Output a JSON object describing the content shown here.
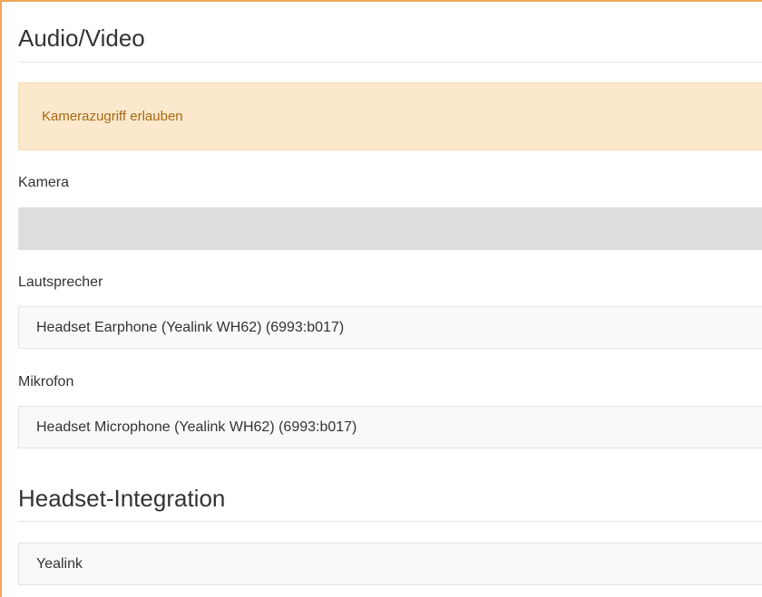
{
  "audio_video": {
    "title": "Audio/Video",
    "alert_text": "Kamerazugriff erlauben",
    "camera": {
      "label": "Kamera",
      "value": ""
    },
    "speaker": {
      "label": "Lautsprecher",
      "value": "Headset Earphone (Yealink WH62) (6993:b017)"
    },
    "microphone": {
      "label": "Mikrofon",
      "value": "Headset Microphone (Yealink WH62) (6993:b017)"
    }
  },
  "headset_integration": {
    "title": "Headset-Integration",
    "value": "Yealink"
  },
  "colors": {
    "accent_border": "#f0a85a",
    "alert_background": "#fce8cd",
    "alert_text": "#a9690f"
  }
}
